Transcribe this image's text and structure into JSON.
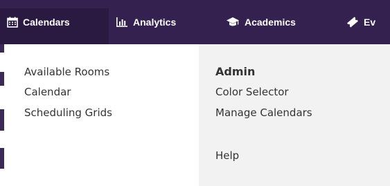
{
  "nav": {
    "items": [
      {
        "label": "Calendars",
        "icon": "calendar-icon",
        "active": true
      },
      {
        "label": "Analytics",
        "icon": "bar-chart-icon"
      },
      {
        "label": "Academics",
        "icon": "graduation-cap-icon"
      },
      {
        "label": "Ev",
        "icon": "ticket-icon"
      }
    ]
  },
  "dropdown": {
    "left_links": [
      "Available Rooms",
      "Calendar",
      "Scheduling Grids"
    ],
    "admin_heading": "Admin",
    "admin_links": [
      "Color Selector",
      "Manage Calendars"
    ],
    "help_label": "Help"
  },
  "colors": {
    "navbar_bg": "#35214f",
    "nav_active_bg": "#2a1a42",
    "dropdown_right_bg": "#f2f2f2",
    "text": "#333333"
  }
}
